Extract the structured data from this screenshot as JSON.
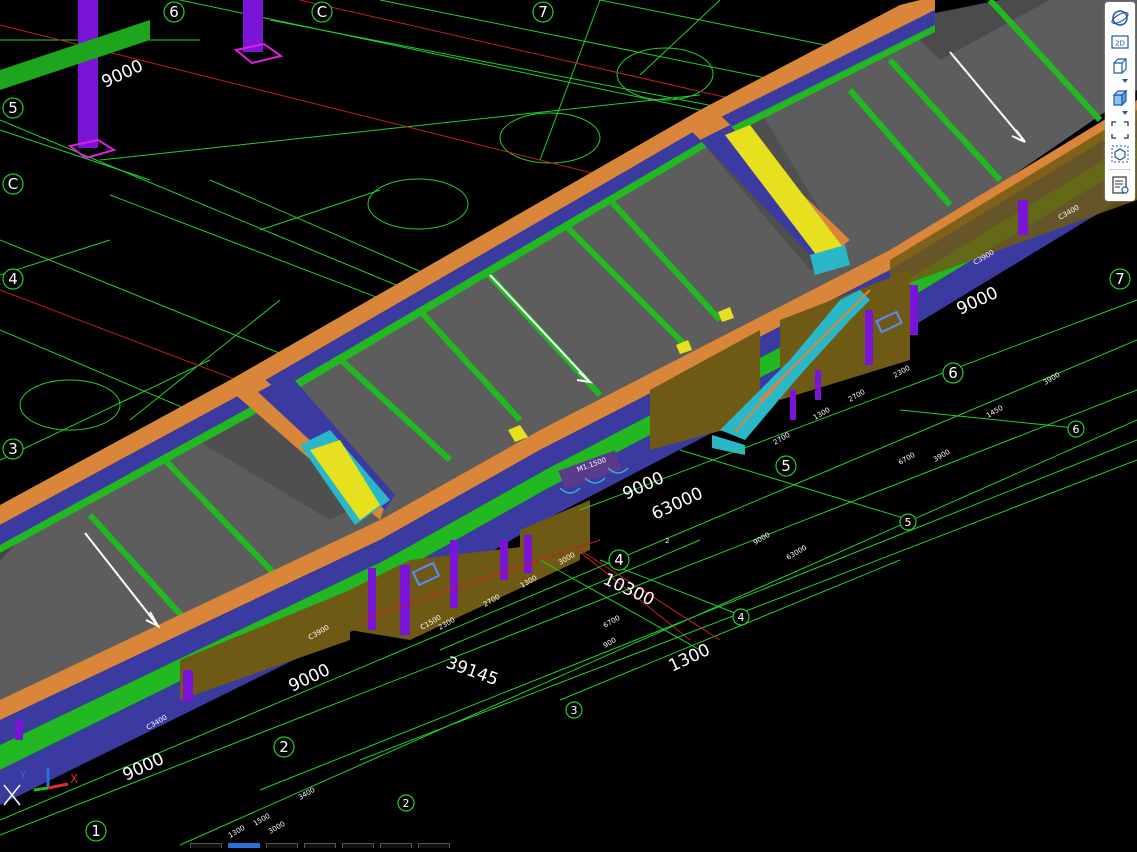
{
  "viewport": {
    "axis_labels": {
      "a6": "6",
      "aC1": "C",
      "a7a": "7",
      "a5": "5",
      "aC2": "C",
      "a4": "4",
      "a3": "3",
      "a7b": "7",
      "a6b": "6",
      "a5b": "5",
      "a4b": "4",
      "a2": "2",
      "a1": "1",
      "c6": "6",
      "c5": "5",
      "c4": "4",
      "c3": "3",
      "c2": "2"
    },
    "dimensions": {
      "d9000_tl": "9000",
      "d9000_r": "9000",
      "d9000_c": "9000",
      "d63000": "63000",
      "d10300": "10300",
      "d39145": "39145",
      "d1300": "1300",
      "d9000_b1": "9000",
      "d9000_b2": "9000"
    },
    "small_labels": {
      "s1": "3000",
      "s2": "2700",
      "s3": "1300",
      "s4": "2700",
      "s5": "2300",
      "s6": "3900",
      "s7": "1450",
      "s8": "6700",
      "s9": "3900",
      "s10": "3400",
      "s11": "1300",
      "s12": "1500",
      "s13": "3000",
      "s14": "C3400",
      "s15": "C3900",
      "s16": "C3900",
      "s17": "C3400",
      "s18": "2300",
      "s19": "1300",
      "s20": "2700",
      "s21": "900",
      "s22": "6700",
      "s23": "9000",
      "s24": "63000",
      "s25": "M1.1500",
      "s26": "C1500",
      "s27": "2"
    },
    "axis_gizmo": {
      "x": "X",
      "y": "Y"
    }
  },
  "toolbar": {
    "buttons": [
      {
        "name": "orbit-icon"
      },
      {
        "name": "2d-view-icon",
        "label": "2D"
      },
      {
        "name": "3d-box-icon"
      },
      {
        "name": "shaded-box-icon"
      },
      {
        "name": "fit-extents-icon"
      },
      {
        "name": "view-cube-icon"
      },
      {
        "name": "properties-list-icon"
      }
    ]
  },
  "colors": {
    "background": "#000000",
    "grid_green": "#1fd12a",
    "roof_gray": "#5d5d5d",
    "wall_blue": "#3a3aa0",
    "parapet_orange": "#d9863a",
    "column_purple": "#7a14d6",
    "olive_wall": "#6e5a14",
    "stair_cyan": "#2ab8c8",
    "yellow": "#e6e01e",
    "red_line": "#c81e1e"
  }
}
